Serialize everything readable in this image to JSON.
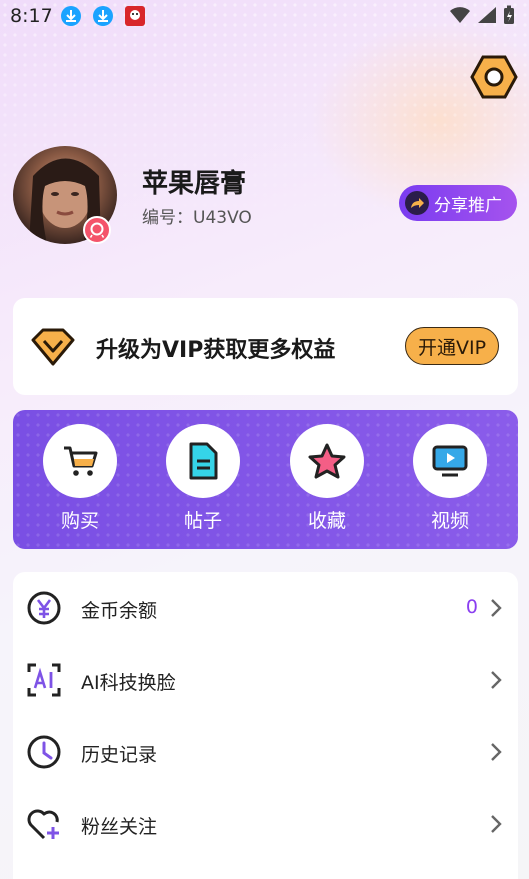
{
  "status_bar": {
    "time": "8:17"
  },
  "profile": {
    "name": "苹果唇膏",
    "id_label": "编号：U43VO",
    "share_label": "分享推广"
  },
  "vip": {
    "title": "升级为VIP获取更多权益",
    "button_label": "开通VIP"
  },
  "quick_actions": [
    {
      "label": "购买",
      "icon": "cart-icon"
    },
    {
      "label": "帖子",
      "icon": "document-icon"
    },
    {
      "label": "收藏",
      "icon": "star-icon"
    },
    {
      "label": "视频",
      "icon": "tv-icon"
    }
  ],
  "menu": [
    {
      "label": "金币余额",
      "value": "0",
      "icon": "coin-icon"
    },
    {
      "label": "AI科技换脸",
      "value": "",
      "icon": "ai-icon"
    },
    {
      "label": "历史记录",
      "value": "",
      "icon": "clock-icon"
    },
    {
      "label": "粉丝关注",
      "value": "",
      "icon": "heart-plus-icon"
    }
  ],
  "colors": {
    "accent_purple": "#7e53e6",
    "vip_orange": "#f7b04a",
    "coin_value": "#8a3ef0"
  }
}
